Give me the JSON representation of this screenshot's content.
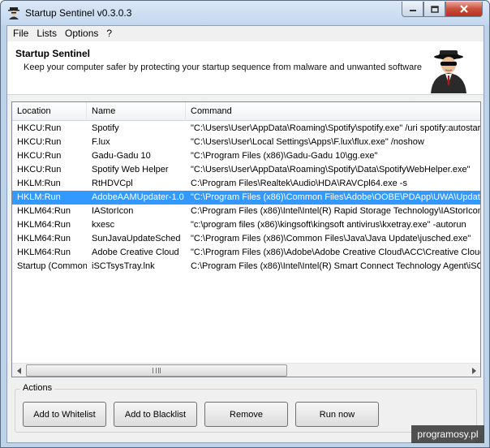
{
  "window": {
    "title": "Startup Sentinel v0.3.0.3",
    "minimize_icon": "minimize-icon",
    "maximize_icon": "maximize-icon",
    "close_icon": "close-icon"
  },
  "menu": [
    "File",
    "Lists",
    "Options",
    "?"
  ],
  "header": {
    "title": "Startup Sentinel",
    "subtitle": "Keep your computer safer by protecting your startup sequence from malware and unwanted software"
  },
  "list": {
    "columns": [
      "Location",
      "Name",
      "Command"
    ],
    "selected_index": 5,
    "rows": [
      {
        "location": "HKCU:Run",
        "name": "Spotify",
        "command": "\"C:\\Users\\User\\AppData\\Roaming\\Spotify\\spotify.exe\" /uri spotify:autostart"
      },
      {
        "location": "HKCU:Run",
        "name": "F.lux",
        "command": "\"C:\\Users\\User\\Local Settings\\Apps\\F.lux\\flux.exe\" /noshow"
      },
      {
        "location": "HKCU:Run",
        "name": "Gadu-Gadu 10",
        "command": "\"C:\\Program Files (x86)\\Gadu-Gadu 10\\gg.exe\""
      },
      {
        "location": "HKCU:Run",
        "name": "Spotify Web Helper",
        "command": "\"C:\\Users\\User\\AppData\\Roaming\\Spotify\\Data\\SpotifyWebHelper.exe\""
      },
      {
        "location": "HKLM:Run",
        "name": "RtHDVCpl",
        "command": "C:\\Program Files\\Realtek\\Audio\\HDA\\RAVCpl64.exe -s"
      },
      {
        "location": "HKLM:Run",
        "name": "AdobeAAMUpdater-1.0",
        "command": "\"C:\\Program Files (x86)\\Common Files\\Adobe\\OOBE\\PDApp\\UWA\\UpdaterStartupUtility.exe\""
      },
      {
        "location": "HKLM64:Run",
        "name": "IAStorIcon",
        "command": "C:\\Program Files (x86)\\Intel\\Intel(R) Rapid Storage Technology\\IAStorIconLaunch.exe"
      },
      {
        "location": "HKLM64:Run",
        "name": "kxesc",
        "command": "\"c:\\program files (x86)\\kingsoft\\kingsoft antivirus\\kxetray.exe\" -autorun"
      },
      {
        "location": "HKLM64:Run",
        "name": "SunJavaUpdateSched",
        "command": "\"C:\\Program Files (x86)\\Common Files\\Java\\Java Update\\jusched.exe\""
      },
      {
        "location": "HKLM64:Run",
        "name": "Adobe Creative Cloud",
        "command": "\"C:\\Program Files (x86)\\Adobe\\Adobe Creative Cloud\\ACC\\Creative Cloud.exe\""
      },
      {
        "location": "Startup (Common)",
        "name": "iSCTsysTray.lnk",
        "command": "C:\\Program Files (x86)\\Intel\\Intel(R) Smart Connect Technology Agent\\iSCTsysTray.exe"
      }
    ]
  },
  "actions": {
    "label": "Actions",
    "buttons": [
      "Add to Whitelist",
      "Add to Blacklist",
      "Remove",
      "Run now"
    ]
  },
  "watermark": "programosy.pl",
  "colors": {
    "selection": "#3399ff",
    "frame": "#bcd3ea"
  }
}
